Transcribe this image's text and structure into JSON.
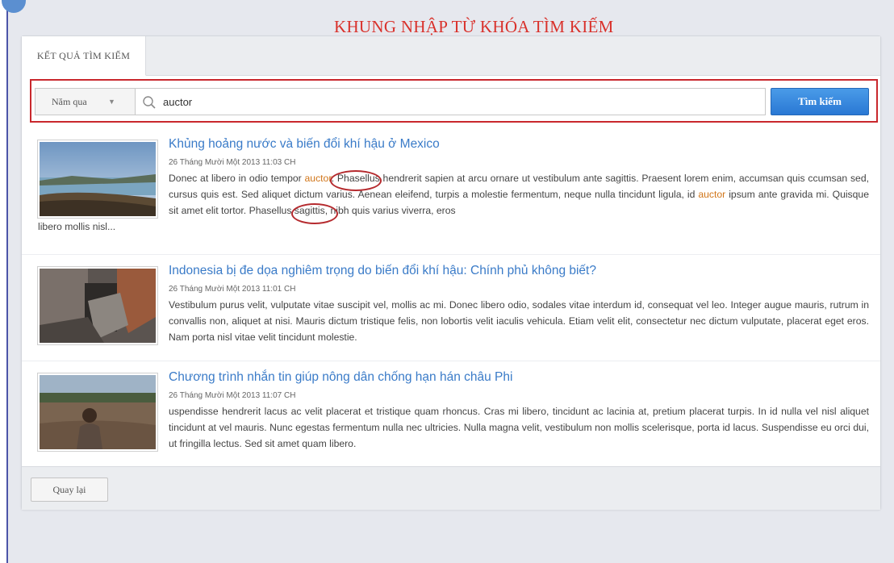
{
  "annotation": {
    "label": "KHUNG NHẬP TỪ KHÓA TÌM KIẾM",
    "color": "#d9312b"
  },
  "tabs": [
    {
      "label": "KẾT QUẢ TÌM KIẾM",
      "active": true
    }
  ],
  "search": {
    "period_label": "Năm qua",
    "query": "auctor",
    "button_label": "Tìm kiếm",
    "icon": "search-icon"
  },
  "results": [
    {
      "title": "Khủng hoảng nước và biến đổi khí hậu ở Mexico",
      "date": "26 Tháng Mười Một 2013  11:03 CH",
      "thumbnail": "lake-shore-photo",
      "body": {
        "t1": "Donec at libero in odio tempor ",
        "k1": "auctor",
        "t2": ". Phasellus hendrerit sapien at arcu ornare ut vestibulum ante sagittis. Praesent lorem enim, accumsan quis ccumsan sed, cursus quis est. Sed aliquet dictum varius. Aenean eleifend, turpis a molestie fermentum, neque nulla tincidunt ligula, id ",
        "k2": "auctor",
        "t3": " ipsum ante gravida mi. Quisque sit amet elit tortor. Phasellus sagittis, nibh quis varius viverra, eros"
      },
      "overflow": "libero mollis nisl..."
    },
    {
      "title": "Indonesia bị đe dọa nghiêm trọng do biến đổi khí hậu: Chính phủ không biết?",
      "date": "26 Tháng Mười Một 2013  11:01 CH",
      "thumbnail": "damaged-building-photo",
      "body": "Vestibulum purus velit, vulputate vitae suscipit vel, mollis ac mi. Donec libero odio, sodales vitae interdum id, consequat vel leo. Integer augue mauris, rutrum in convallis non, aliquet at nisi. Mauris dictum tristique felis, non lobortis velit iaculis vehicula. Etiam velit elit, consectetur nec dictum vulputate, placerat eget eros. Nam porta nisl vitae velit tincidunt molestie."
    },
    {
      "title": "Chương trình nhắn tin giúp nông dân chống hạn hán châu Phi",
      "date": "26 Tháng Mười Một 2013  11:07 CH",
      "thumbnail": "child-in-field-photo",
      "body": "uspendisse hendrerit lacus ac velit placerat et tristique quam rhoncus. Cras mi libero, tincidunt ac lacinia at, pretium placerat turpis. In id nulla vel nisl aliquet tincidunt at vel mauris. Nunc egestas fermentum nulla nec ultricies. Nulla magna velit, vestibulum non mollis scelerisque, porta id lacus. Suspendisse eu orci dui, ut fringilla lectus. Sed sit amet quam libero."
    }
  ],
  "footer": {
    "back_label": "Quay lại"
  },
  "colors": {
    "link": "#3a7bc8",
    "keyword": "#d1761a",
    "highlight_border": "#c9282d",
    "primary_button": "#2a78d4"
  }
}
